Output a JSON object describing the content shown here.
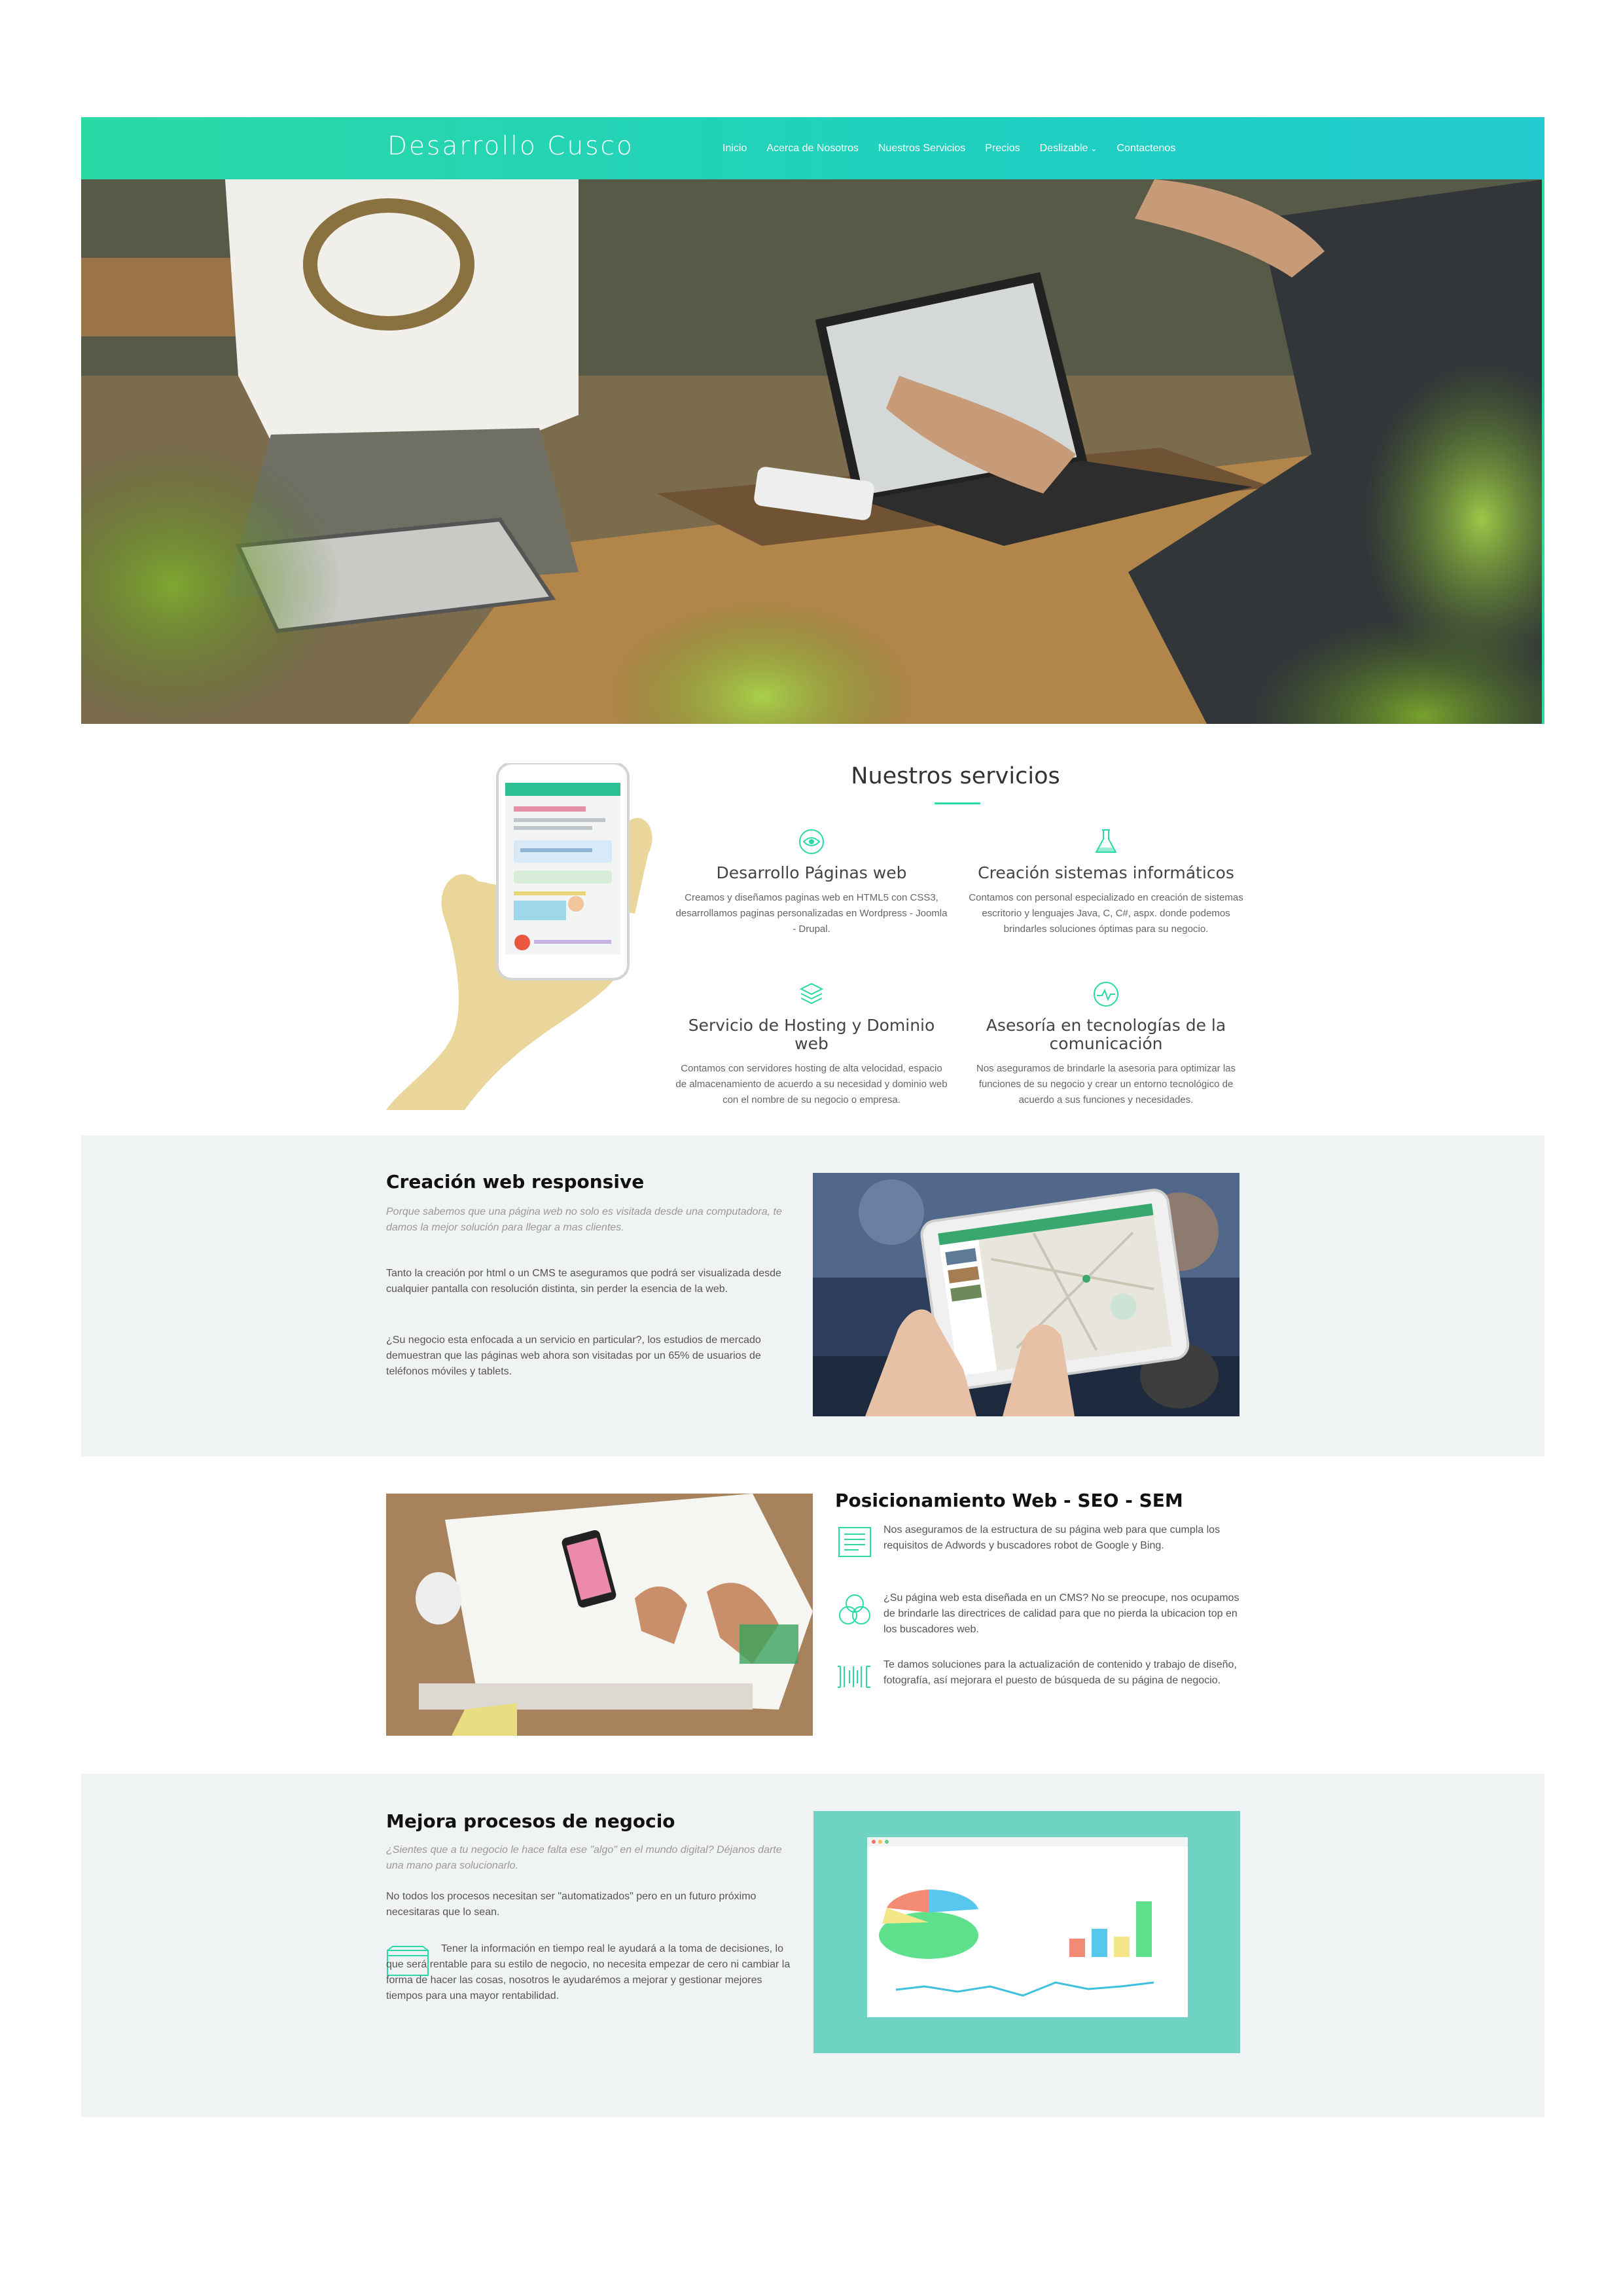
{
  "header": {
    "brand": "Desarrollo Cusco",
    "nav": [
      "Inicio",
      "Acerca de Nosotros",
      "Nuestros Servicios",
      "Precios",
      "Deslizable",
      "Contactenos"
    ]
  },
  "services": {
    "title": "Nuestros servicios",
    "items": [
      {
        "title": "Desarrollo Páginas web",
        "text": "Creamos y diseñamos paginas web en HTML5 con CSS3, desarrollamos paginas personalizadas en Wordpress - Joomla - Drupal.",
        "icon": "eye-icon"
      },
      {
        "title": "Creación sistemas informáticos",
        "text": "Contamos con personal especializado en creación de sistemas escritorio y lenguajes Java, C, C#, aspx. donde podemos brindarles soluciones óptimas para su negocio.",
        "icon": "flask-icon"
      },
      {
        "title": "Servicio de Hosting y Dominio web",
        "text": "Contamos con servidores hosting de alta velocidad, espacio de almacenamiento de acuerdo a su necesidad y dominio web con el nombre de su negocio o empresa.",
        "icon": "layers-icon"
      },
      {
        "title": "Asesoría en tecnologías de la comunicación",
        "text": "Nos aseguramos de brindarle la asesoria para optimizar las funciones de su negocio y crear un entorno tecnológico de acuerdo a sus funciones y necesidades.",
        "icon": "pulse-icon"
      }
    ]
  },
  "responsive": {
    "title": "Creación web responsive",
    "intro": "Porque sabemos que una página web no solo es visitada desde una computadora, te damos la mejor solución para llegar a mas clientes.",
    "p1": "Tanto la creación por html o un CMS te aseguramos que podrá ser visualizada desde cualquier pantalla con resolución distinta, sin perder la esencia de la web.",
    "p2": "¿Su negocio esta enfocada a un servicio en particular?, los estudios de mercado demuestran que las páginas web ahora son visitadas por un 65% de usuarios de teléfonos móviles y tablets."
  },
  "seo": {
    "title": "Posicionamiento Web - SEO - SEM",
    "features": [
      "Nos aseguramos de la estructura de su página web para que cumpla los requisitos de Adwords y buscadores robot de Google y Bing.",
      "¿Su página web esta diseñada en un CMS? No se preocupe, nos ocupamos de brindarle las directrices de calidad para que no pierda la ubicacion top en los buscadores web.",
      "Te damos soluciones para la actualización de contenido y trabajo de diseño, fotografía, así mejorara el puesto de búsqueda de su página de negocio."
    ]
  },
  "procesos": {
    "title": "Mejora procesos de negocio",
    "intro": "¿Sientes que a tu negocio le hace falta ese \"algo\" en el mundo digital? Déjanos darte una mano para solucionarlo.",
    "p1": "No todos los procesos necesitan ser \"automatizados\" pero en un futuro próximo necesitaras que lo sean.",
    "p2": "Tener la información en tiempo real le ayudará a la toma de decisiones, lo que será rentable para su estilo de negocio, no necesita empezar de cero ni cambiar la forma de hacer las cosas, nosotros le ayudarémos a mejorar y gestionar mejores tiempos para una mayor rentabilidad."
  },
  "colors": {
    "accent": "#2bd9a5",
    "band": "#eff3f4",
    "teal_panel": "#6fd3c3"
  }
}
